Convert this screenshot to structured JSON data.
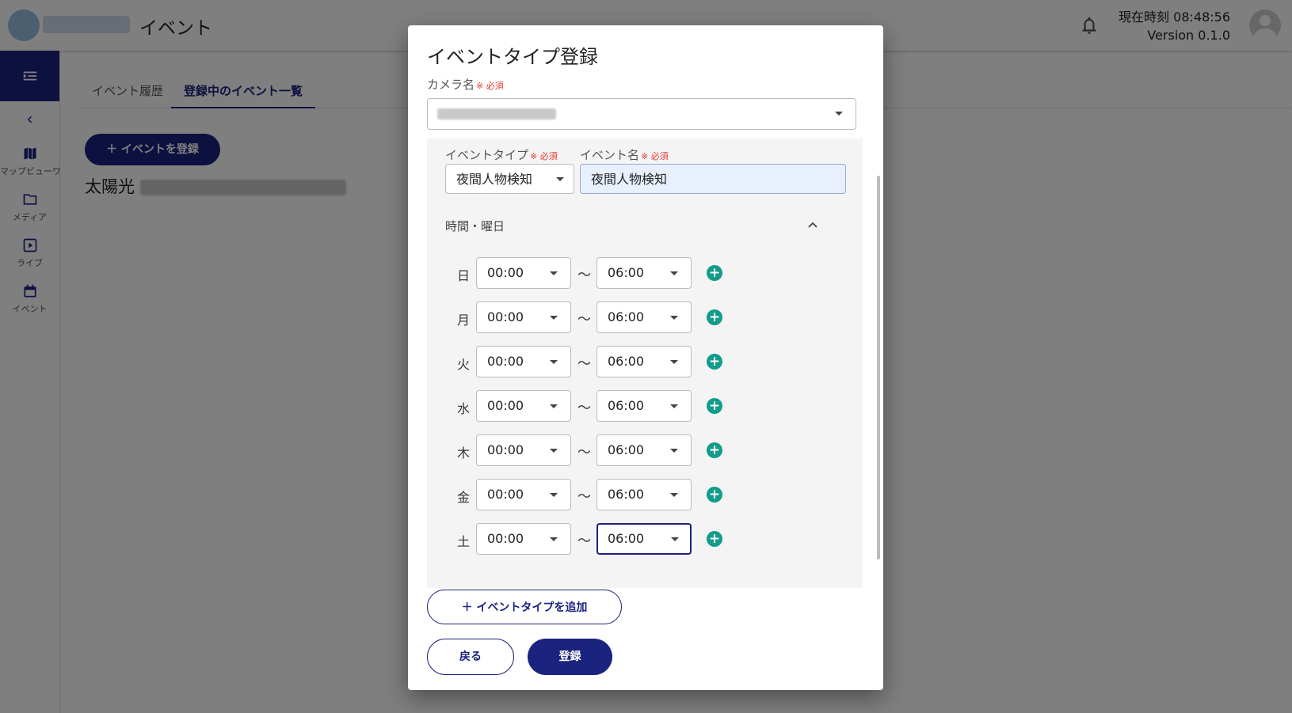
{
  "header": {
    "app_title": "イベント",
    "clock_label": "現在時刻 08:48:56",
    "version_label": "Version 0.1.0"
  },
  "sidebar": {
    "items": [
      {
        "label": "マップビューワ",
        "icon": "map-icon"
      },
      {
        "label": "メディア",
        "icon": "folder-icon"
      },
      {
        "label": "ライブ",
        "icon": "play-icon"
      },
      {
        "label": "イベント",
        "icon": "calendar-icon"
      }
    ]
  },
  "main": {
    "tabs": [
      {
        "label": "イベント履歴"
      },
      {
        "label": "登録中のイベント一覧"
      }
    ],
    "register_button": "＋ イベントを登録",
    "plant_name": "太陽光"
  },
  "dialog": {
    "title": "イベントタイプ登録",
    "camera_label": "カメラ名",
    "required_mark": "※ 必須",
    "event_type_label": "イベントタイプ",
    "event_type_value": "夜間人物検知",
    "event_name_label": "イベント名",
    "event_name_value": "夜間人物検知",
    "section_title": "時間・曜日",
    "tilde": "〜",
    "schedule": [
      {
        "day": "日",
        "start": "00:00",
        "end": "06:00"
      },
      {
        "day": "月",
        "start": "00:00",
        "end": "06:00"
      },
      {
        "day": "火",
        "start": "00:00",
        "end": "06:00"
      },
      {
        "day": "水",
        "start": "00:00",
        "end": "06:00"
      },
      {
        "day": "木",
        "start": "00:00",
        "end": "06:00"
      },
      {
        "day": "金",
        "start": "00:00",
        "end": "06:00"
      },
      {
        "day": "土",
        "start": "00:00",
        "end": "06:00"
      }
    ],
    "add_type_button": "＋ イベントタイプを追加",
    "back_button": "戻る",
    "submit_button": "登録"
  },
  "colors": {
    "primary": "#1a237e",
    "accent_add": "#139b8b",
    "required": "#e53935"
  }
}
